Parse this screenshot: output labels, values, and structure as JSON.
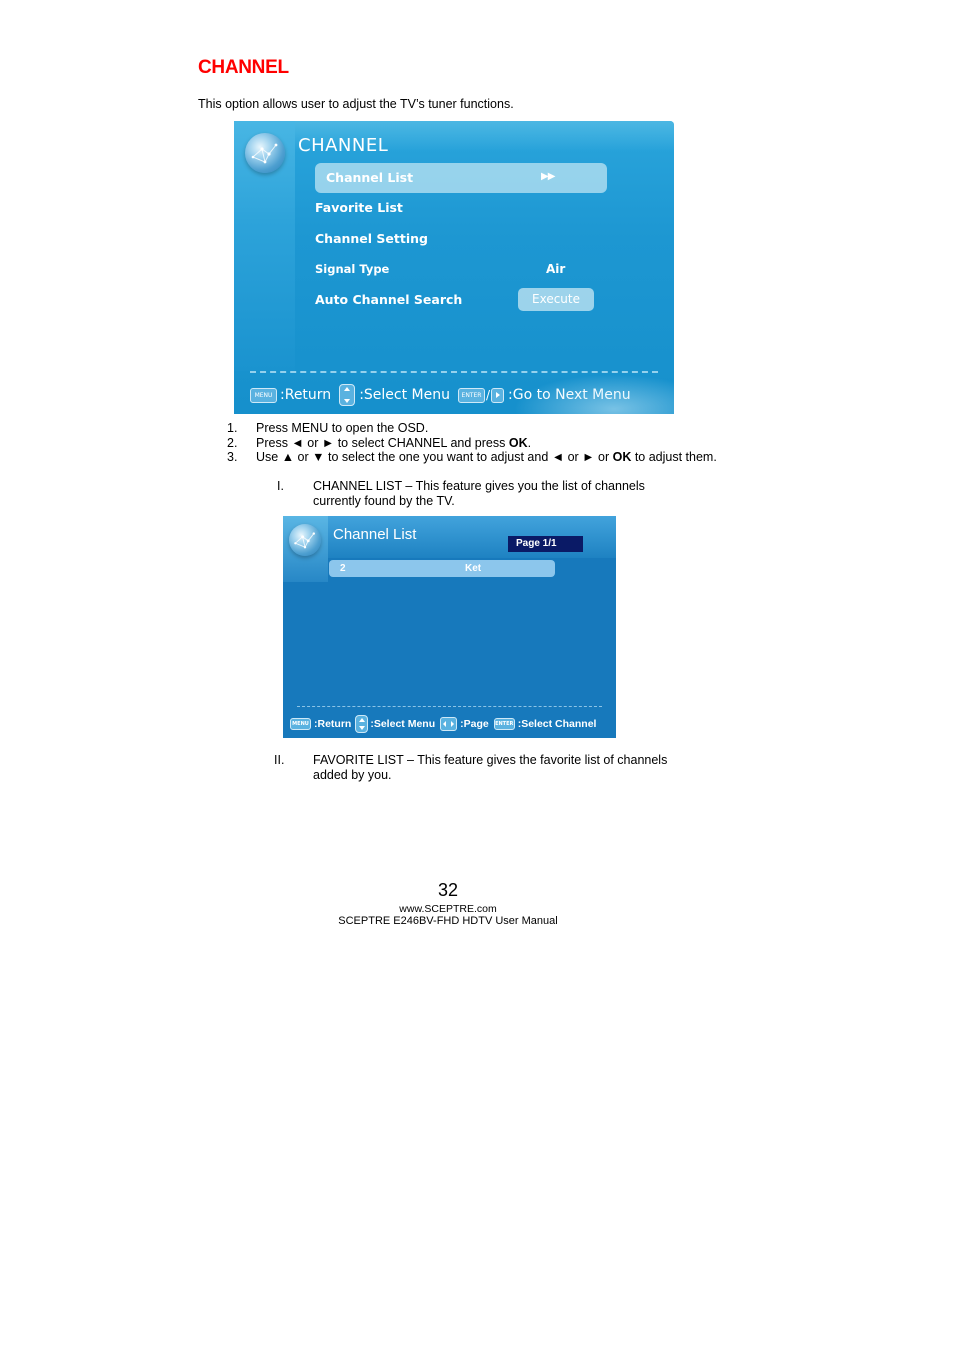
{
  "section": {
    "heading": "CHANNEL",
    "intro": "This option allows user to adjust the TV’s tuner functions."
  },
  "osd_channel": {
    "icon": "globe-icon",
    "title": "CHANNEL",
    "items": [
      {
        "label": "Channel List",
        "value": "▶▶",
        "selected": true
      },
      {
        "label": "Favorite List",
        "value": ""
      },
      {
        "label": "Channel Setting",
        "value": ""
      },
      {
        "label": "Signal Type",
        "value": "Air"
      },
      {
        "label": "Auto Channel Search",
        "value": "Execute"
      }
    ],
    "footer": {
      "menu_key": "MENU",
      "return_label": ":Return",
      "select_label": ":Select Menu",
      "enter_key": "ENTER",
      "slash": "/",
      "next_label": ":Go to Next Menu"
    },
    "colors": {
      "background": "#1a93cf",
      "highlight": "#bee4f3"
    }
  },
  "steps": [
    {
      "num": "1.",
      "text": "Press MENU to open the OSD."
    },
    {
      "num": "2.",
      "pre": "Press ◄ or ► to select CHANNEL and press ",
      "bold": "OK",
      "post": "."
    },
    {
      "num": "3.",
      "pre": "Use ▲ or ▼ to select the one you want to adjust and ◄ or ► or ",
      "bold": "OK",
      "post": " to adjust them."
    }
  ],
  "subitems": [
    {
      "num": "I.",
      "text": "CHANNEL LIST – This feature gives you the list of channels currently found by the TV."
    },
    {
      "num": "II.",
      "text": "FAVORITE LIST – This feature gives the favorite list of channels added by you."
    }
  ],
  "osd_channel_list": {
    "icon": "globe-icon",
    "title": "Channel List",
    "page": "Page 1/1",
    "rows": [
      {
        "number": "2",
        "name": "Ket"
      }
    ],
    "footer": {
      "menu_key": "MENU",
      "return_label": ":Return",
      "select_label": ":Select Menu",
      "page_label": ":Page",
      "enter_key": "ENTER",
      "select_channel_label": ":Select Channel"
    },
    "colors": {
      "background": "#1779bc",
      "page_box": "#0a1a66",
      "row_highlight": "#8cc6ec"
    }
  },
  "footer": {
    "page_number": "32",
    "website": "www.SCEPTRE.com",
    "manual": "SCEPTRE E246BV-FHD HDTV User Manual"
  },
  "colors": {
    "heading": "#ff0000"
  }
}
